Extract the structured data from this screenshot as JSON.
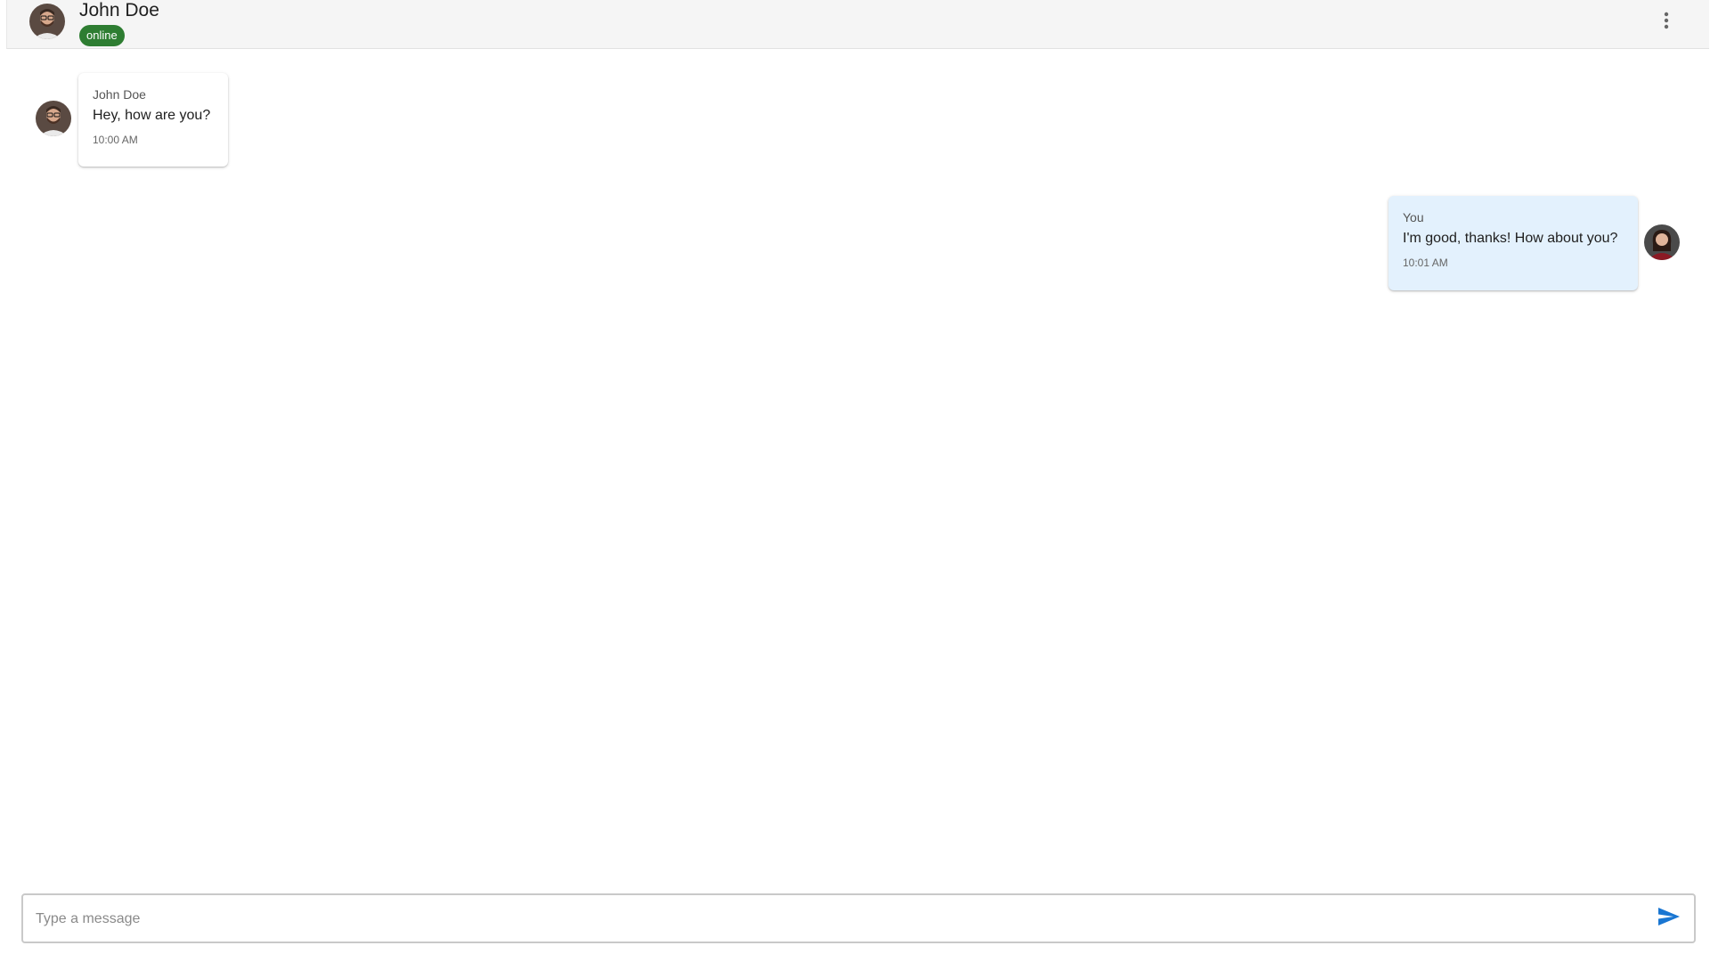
{
  "header": {
    "contact_name": "John Doe",
    "status": "online",
    "status_color": "#2e7d32",
    "menu_icon": "more-vert-icon"
  },
  "messages": [
    {
      "direction": "incoming",
      "sender": "John Doe",
      "text": "Hey, how are you?",
      "time": "10:00 AM",
      "bubble_color": "#ffffff"
    },
    {
      "direction": "outgoing",
      "sender": "You",
      "text": "I'm good, thanks! How about you?",
      "time": "10:01 AM",
      "bubble_color": "#e3f1fd"
    }
  ],
  "composer": {
    "placeholder": "Type a message",
    "value": "",
    "send_icon": "send-icon",
    "accent_color": "#1976d2"
  }
}
